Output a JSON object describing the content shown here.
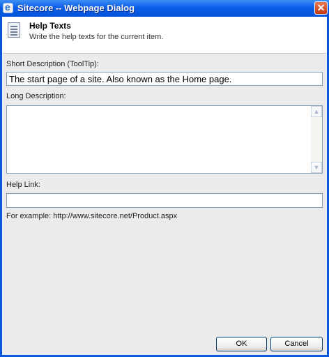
{
  "window": {
    "title": "Sitecore -- Webpage Dialog",
    "close_symbol": "✕"
  },
  "header": {
    "title": "Help Texts",
    "subtitle": "Write the help texts for the current item."
  },
  "form": {
    "short_label": "Short Description (ToolTip):",
    "short_value": "The start page of a site.  Also known as the Home page.",
    "long_label": "Long Description:",
    "long_value": "",
    "link_label": "Help Link:",
    "link_value": "",
    "example": "For example: http://www.sitecore.net/Product.aspx"
  },
  "buttons": {
    "ok": "OK",
    "cancel": "Cancel"
  },
  "icons": {
    "title": "ie-icon",
    "header": "document-icon",
    "close": "close-icon"
  },
  "colors": {
    "titlebar": "#0553d8",
    "close": "#c8370e",
    "background": "#ebebeb"
  }
}
